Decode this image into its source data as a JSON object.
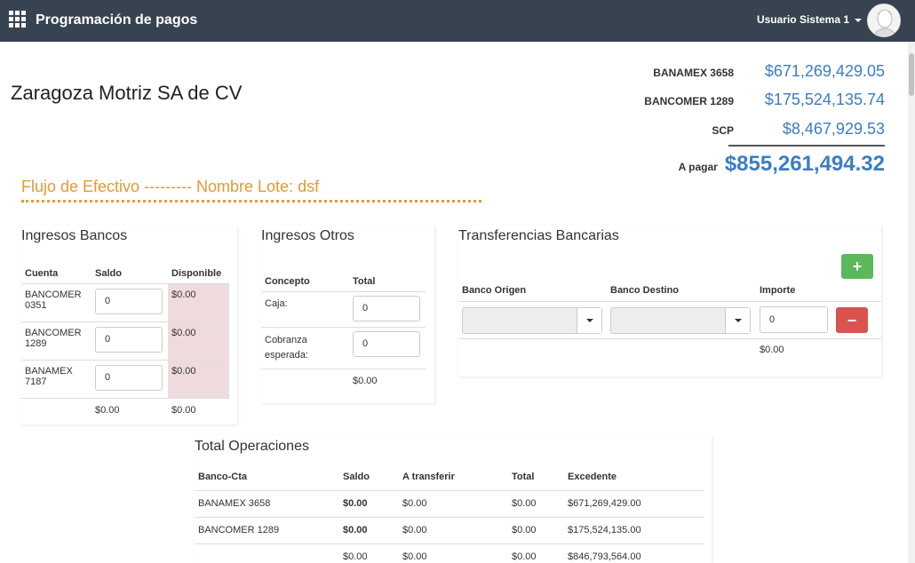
{
  "header": {
    "app_title": "Programación de pagos",
    "user_name": "Usuario Sistema 1",
    "icons": [
      "apps-grid-icon",
      "caret-down-icon",
      "user-avatar-icon"
    ]
  },
  "company_name": "Zaragoza Motriz SA de CV",
  "summary": {
    "rows": [
      {
        "label": "BANAMEX 3658",
        "value": "$671,269,429.05"
      },
      {
        "label": "BANCOMER 1289",
        "value": "$175,524,135.74"
      },
      {
        "label": "SCP",
        "value": "$8,467,929.53"
      }
    ],
    "total_label": "A pagar",
    "total_value": "$855,261,494.32"
  },
  "flujo_title": "Flujo de Efectivo --------- Nombre Lote: dsf",
  "ingresos_bancos": {
    "title": "Ingresos Bancos",
    "headers": [
      "Cuenta",
      "Saldo",
      "Disponible"
    ],
    "rows": [
      {
        "cuenta": "BANCOMER 0351",
        "saldo": "0",
        "disponible": "$0.00"
      },
      {
        "cuenta": "BANCOMER 1289",
        "saldo": "0",
        "disponible": "$0.00"
      },
      {
        "cuenta": "BANAMEX 7187",
        "saldo": "0",
        "disponible": "$0.00"
      }
    ],
    "footer": {
      "saldo": "$0.00",
      "disponible": "$0.00"
    }
  },
  "ingresos_otros": {
    "title": "Ingresos Otros",
    "headers": [
      "Concepto",
      "Total"
    ],
    "rows": [
      {
        "concepto": "Caja:",
        "total": "0"
      },
      {
        "concepto": "Cobranza esperada:",
        "total": "0"
      }
    ],
    "footer": {
      "total": "$0.00"
    }
  },
  "transferencias": {
    "title": "Transferencias Bancarias",
    "headers": [
      "Banco Origen",
      "Banco Destino",
      "Importe"
    ],
    "add_label": "+",
    "delete_label": "−",
    "row": {
      "origen": "",
      "destino": "",
      "importe": "0"
    },
    "footer": {
      "importe": "$0.00"
    }
  },
  "total_operaciones": {
    "title": "Total Operaciones",
    "headers": [
      "Banco-Cta",
      "Saldo",
      "A transferir",
      "Total",
      "Excedente"
    ],
    "rows": [
      {
        "banco": "BANAMEX 3658",
        "saldo": "$0.00",
        "transferir": "$0.00",
        "total": "$0.00",
        "excedente": "$671,269,429.00"
      },
      {
        "banco": "BANCOMER 1289",
        "saldo": "$0.00",
        "transferir": "$0.00",
        "total": "$0.00",
        "excedente": "$175,524,135.00"
      }
    ],
    "footer": {
      "banco": "",
      "saldo": "$0.00",
      "transferir": "$0.00",
      "total": "$0.00",
      "excedente": "$846,793,564.00"
    }
  },
  "colors": {
    "topbar": "#374350",
    "accent_blue": "#3a7dc4",
    "accent_orange": "#e09a33",
    "success": "#5cb85c",
    "danger": "#d9534f",
    "pink_cell": "#efdbdd"
  }
}
